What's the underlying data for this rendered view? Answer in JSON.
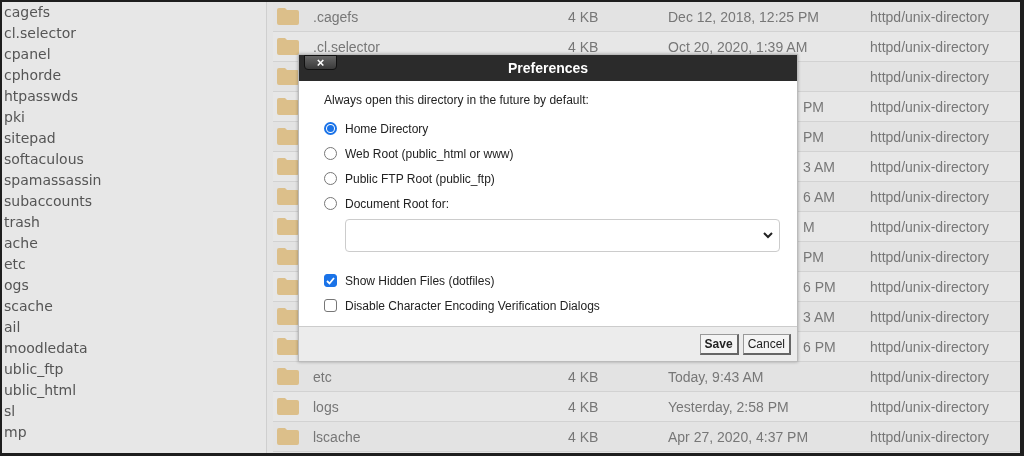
{
  "sidebar": {
    "items": [
      "cagefs",
      "cl.selector",
      "cpanel",
      "cphorde",
      "htpasswds",
      "pki",
      "sitepad",
      "softaculous",
      "spamassassin",
      "subaccounts",
      "trash",
      "ache",
      "etc",
      "ogs",
      "scache",
      "ail",
      "moodledata",
      "ublic_ftp",
      "ublic_html",
      "sl",
      "mp"
    ]
  },
  "table": {
    "rows": [
      {
        "kind": "full",
        "name": ".cagefs",
        "size": "4 KB",
        "date": "Dec 12, 2018, 12:25 PM",
        "type": "httpd/unix-directory"
      },
      {
        "kind": "full",
        "name": ".cl.selector",
        "size": "4 KB",
        "date": "Oct 20, 2020, 1:39 AM",
        "type": "httpd/unix-directory"
      },
      {
        "kind": "covered",
        "type": "httpd/unix-directory"
      },
      {
        "kind": "covered",
        "date": "PM",
        "type": "httpd/unix-directory"
      },
      {
        "kind": "covered",
        "date": "PM",
        "type": "httpd/unix-directory"
      },
      {
        "kind": "covered",
        "date": "3 AM",
        "type": "httpd/unix-directory"
      },
      {
        "kind": "covered",
        "date": "6 AM",
        "type": "httpd/unix-directory"
      },
      {
        "kind": "covered",
        "date": "M",
        "type": "httpd/unix-directory"
      },
      {
        "kind": "covered",
        "date": "PM",
        "type": "httpd/unix-directory"
      },
      {
        "kind": "covered",
        "date": "6 PM",
        "type": "httpd/unix-directory"
      },
      {
        "kind": "covered",
        "date": "3 AM",
        "type": "httpd/unix-directory"
      },
      {
        "kind": "covered",
        "date": "6 PM",
        "type": "httpd/unix-directory"
      },
      {
        "kind": "full",
        "name": "etc",
        "size": "4 KB",
        "date": "Today, 9:43 AM",
        "type": "httpd/unix-directory"
      },
      {
        "kind": "full",
        "name": "logs",
        "size": "4 KB",
        "date": "Yesterday, 2:58 PM",
        "type": "httpd/unix-directory"
      },
      {
        "kind": "full",
        "name": "lscache",
        "size": "4 KB",
        "date": "Apr 27, 2020, 4:37 PM",
        "type": "httpd/unix-directory"
      }
    ]
  },
  "dialog": {
    "close": "×",
    "title": "Preferences",
    "prompt": "Always open this directory in the future by default:",
    "options": [
      {
        "label": "Home Directory",
        "selected": true
      },
      {
        "label": "Web Root (public_html or www)",
        "selected": false
      },
      {
        "label": "Public FTP Root (public_ftp)",
        "selected": false
      },
      {
        "label": "Document Root for:",
        "selected": false
      }
    ],
    "checkboxes": [
      {
        "label": "Show Hidden Files (dotfiles)",
        "checked": true
      },
      {
        "label": "Disable Character Encoding Verification Dialogs",
        "checked": false
      }
    ],
    "buttons": [
      "Save",
      "Cancel"
    ]
  }
}
